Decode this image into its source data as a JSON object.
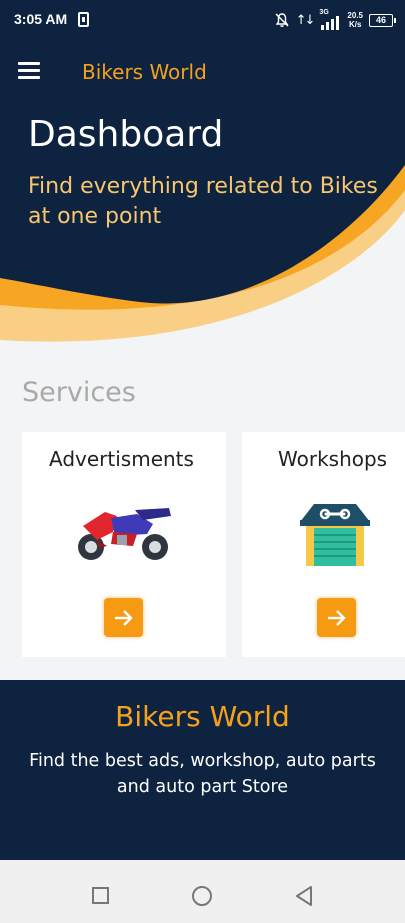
{
  "status_bar": {
    "time": "3:05 AM",
    "network_type": "3G",
    "speed_value": "20.5",
    "speed_unit": "K/s",
    "battery": "46",
    "arrows": "↑↓"
  },
  "header": {
    "app_title": "Bikers World",
    "menu_icon": "hamburger-menu-icon"
  },
  "hero": {
    "title": "Dashboard",
    "subtitle": "Find everything related to Bikes at one point"
  },
  "services": {
    "title": "Services",
    "cards": [
      {
        "label": "Advertisments",
        "icon": "motorcycle-icon"
      },
      {
        "label": "Workshops",
        "icon": "garage-workshop-icon"
      }
    ]
  },
  "footer": {
    "title": "Bikers World",
    "text": "Find the best ads, workshop, auto parts and auto part Store"
  },
  "colors": {
    "navy": "#0d2340",
    "orange": "#f5a11c",
    "light_orange": "#f7c66e",
    "background": "#f3f4f6"
  }
}
